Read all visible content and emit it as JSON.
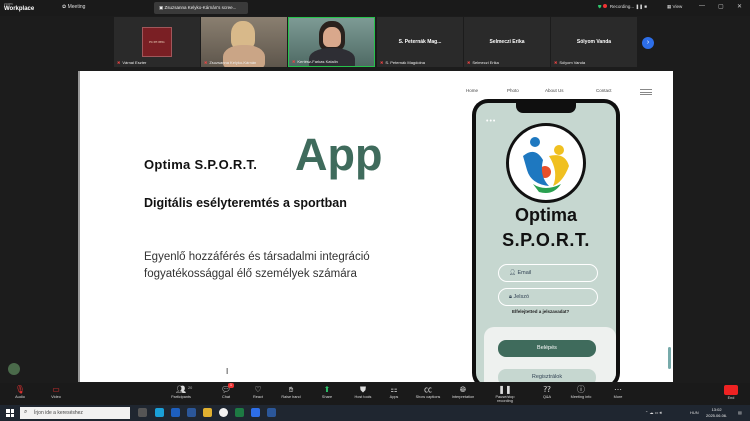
{
  "app": {
    "brand_small": "zoom",
    "brand_big": "Workplace",
    "meeting_label": "Meeting"
  },
  "share_banner": "Zsuzsanna Kelyko-Kárnán's scree...",
  "recording": "Recording...",
  "view_label": "View",
  "window_controls": [
    "—",
    "▢",
    "✕"
  ],
  "participants": [
    {
      "name": "Várnai Eszter",
      "type": "logo",
      "logo_text": "ELTE PPK"
    },
    {
      "name": "Zsuzsanna Kelyko-Kárnán",
      "type": "video"
    },
    {
      "name": "Kertész-Farkas Katalin",
      "type": "video"
    },
    {
      "name": "S. Peternák Magdolna",
      "type": "name",
      "display": "S. Peternák Mag..."
    },
    {
      "name": "Selmeczi Erika",
      "type": "name",
      "display": "Selmeczi Erika"
    },
    {
      "name": "Sólyom Vanda",
      "type": "name",
      "display": "Sólyom Vanda"
    }
  ],
  "slide": {
    "nav": [
      "Home",
      "Photo",
      "About Us",
      "Contact"
    ],
    "title": "Optima S.P.O.R.T.",
    "app_word": "App",
    "subtitle": "Digitális esélyteremtés a sportban",
    "description": "Egyenlő hozzáférés és társadalmi integráció fogyatékossággal élő személyek számára",
    "accent_color": "#3f6b5c"
  },
  "phone": {
    "app_name_line1": "Optima",
    "app_name_line2": "S.P.O.R.T.",
    "email_placeholder": "Email",
    "password_placeholder": "Jelszó",
    "forgot_password": "Elfelejtetted a jelszavadat?",
    "login_button": "Belépés",
    "register_button": "Regisztrálok"
  },
  "toolbar": {
    "audio": "Audio",
    "video": "Video",
    "participants": "Participants",
    "participants_count": "20",
    "chat": "Chat",
    "chat_badge": "1",
    "react": "React",
    "raise_hand": "Raise hand",
    "share": "Share",
    "host_tools": "Host tools",
    "apps": "Apps",
    "show_captions": "Show captions",
    "interpretation": "Interpretation",
    "pause_recording": "Pause/stop recording",
    "qa": "Q&A",
    "meeting_info": "Meeting info",
    "more": "More",
    "end": "End"
  },
  "taskbar": {
    "search_placeholder": "Írjon ide a kereséshez",
    "lang": "HUN",
    "time": "13:02",
    "date": "2025.06.06."
  }
}
